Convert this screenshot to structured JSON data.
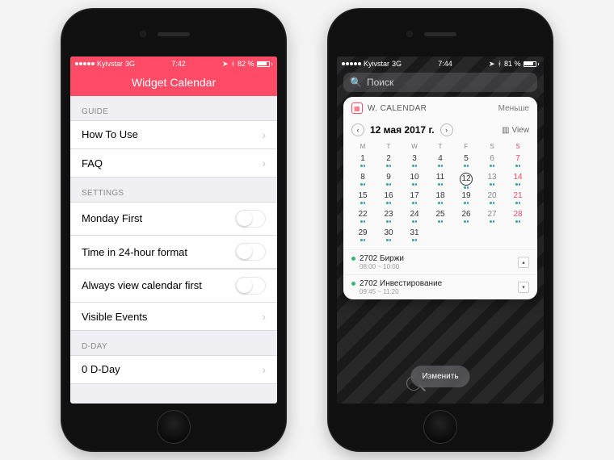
{
  "left": {
    "status": {
      "carrier": "Kyivstar",
      "net": "3G",
      "time": "7:42",
      "battery": "82 %"
    },
    "title": "Widget Calendar",
    "sections": {
      "guide": {
        "header": "GUIDE",
        "items": [
          "How To Use",
          "FAQ"
        ]
      },
      "settings": {
        "header": "SETTINGS",
        "toggles": [
          "Monday First",
          "Time in 24-hour format",
          "Always view calendar first"
        ],
        "link": "Visible Events"
      },
      "dday": {
        "header": "D-DAY",
        "items": [
          "0 D-Day"
        ]
      }
    }
  },
  "right": {
    "status": {
      "carrier": "Kyivstar",
      "net": "3G",
      "time": "7:44",
      "battery": "81 %"
    },
    "search_placeholder": "Поиск",
    "widget": {
      "name": "W. CALENDAR",
      "collapse": "Меньше",
      "date_title": "12 мая 2017 г.",
      "view_label": "View",
      "dow": [
        "M",
        "T",
        "W",
        "T",
        "F",
        "S",
        "S"
      ],
      "events": [
        {
          "title": "2702 Биржи",
          "time": "08:00 ~ 10:00"
        },
        {
          "title": "2702 Инвестирование",
          "time": "09:45 ~ 11:20"
        }
      ]
    },
    "edit_label": "Изменить"
  }
}
